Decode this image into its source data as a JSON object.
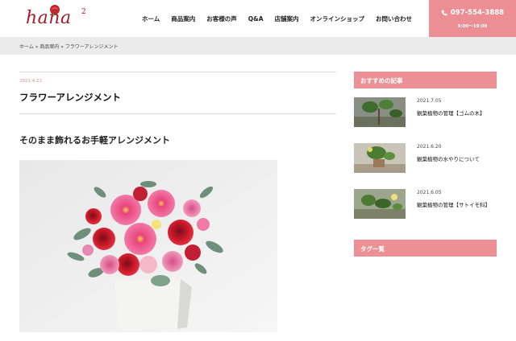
{
  "header": {
    "logo_text": "hana",
    "logo_sup": "2",
    "nav": [
      "ホーム",
      "商品案内",
      "お客様の声",
      "Q&A",
      "店舗案内",
      "オンラインショップ",
      "お問い合わせ"
    ],
    "tel": "097-554-3888",
    "hours": "9:00〜19:00"
  },
  "breadcrumb": "ホーム » 商品案内 » フラワーアレンジメント",
  "post": {
    "date": "2021.4.22",
    "title": "フラワーアレンジメント",
    "subtitle": "そのまま飾れるお手軽アレンジメント"
  },
  "sidebar": {
    "recommended_heading": "おすすめの記事",
    "posts": [
      {
        "date": "2021.7.05",
        "title": "観葉植物の管理【ゴムの木】"
      },
      {
        "date": "2021.6.20",
        "title": "観葉植物の水やりについて"
      },
      {
        "date": "2021.6.05",
        "title": "観葉植物の管理【サトイモ科】"
      }
    ],
    "tags_heading": "タグ一覧"
  },
  "colors": {
    "accent_pink": "#eb8f94",
    "logo_red": "#a01e2a",
    "breadcrumb_bg": "#ebebeb"
  }
}
